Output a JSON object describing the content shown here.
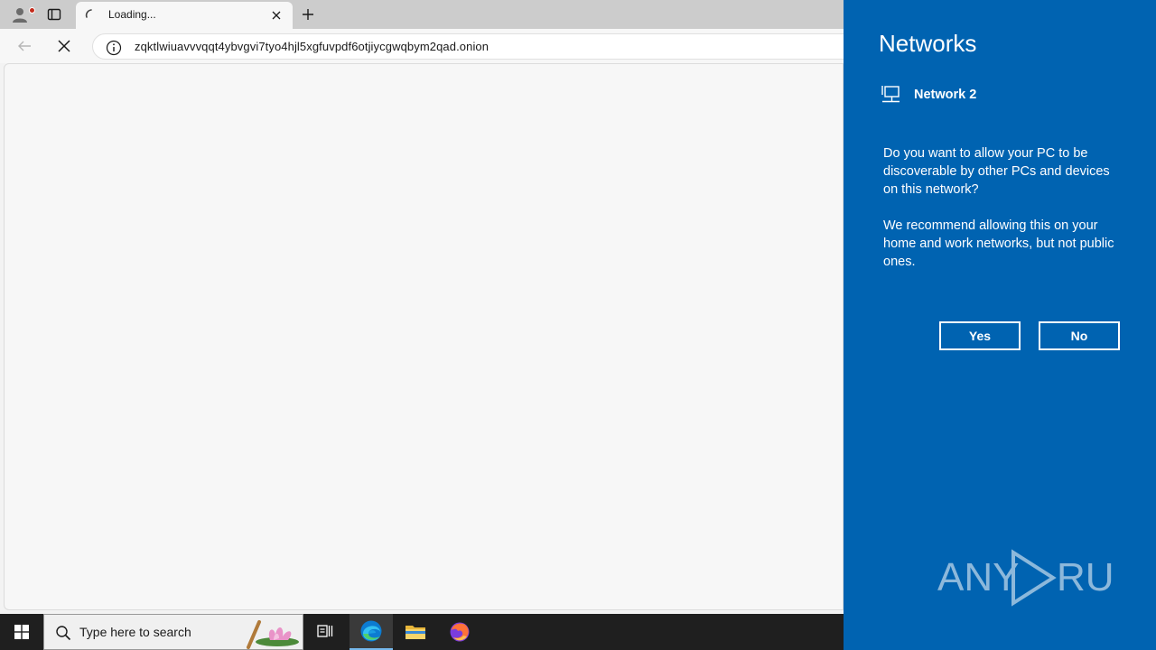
{
  "browser": {
    "tab": {
      "title": "Loading..."
    },
    "address": {
      "url": "zqktlwiuavvvqqt4ybvgvi7tyo4hjl5xgfuvpdf6otjiycgwqbym2qad.onion"
    }
  },
  "taskbar": {
    "search_placeholder": "Type here to search",
    "apps": [
      "task-view",
      "edge",
      "file-explorer",
      "firefox"
    ]
  },
  "networks_flyout": {
    "title": "Networks",
    "network_name": "Network 2",
    "question": "Do you want to allow your PC to be discoverable by other PCs and devices on this network?",
    "recommendation": "We recommend allowing this on your home and work networks, but not public ones.",
    "yes_label": "Yes",
    "no_label": "No",
    "watermark": "ANY RUN"
  },
  "colors": {
    "flyout_bg": "#0063b1",
    "taskbar_bg": "#1f1f1f",
    "tabstrip_bg": "#cccccc"
  }
}
